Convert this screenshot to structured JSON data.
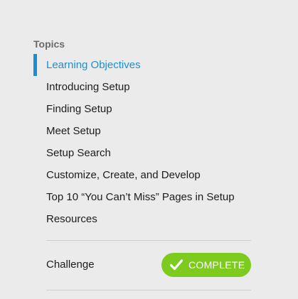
{
  "topics": {
    "heading": "Topics",
    "items": [
      {
        "label": "Learning Objectives"
      },
      {
        "label": "Introducing Setup"
      },
      {
        "label": "Finding Setup"
      },
      {
        "label": "Meet Setup"
      },
      {
        "label": "Setup Search"
      },
      {
        "label": "Customize, Create, and Develop"
      },
      {
        "label": "Top 10 “You Can’t Miss” Pages in Setup"
      },
      {
        "label": "Resources"
      }
    ],
    "active_index": 0
  },
  "challenge": {
    "label": "Challenge",
    "status_label": "COMPLETE",
    "status_icon": "checkmark-icon"
  },
  "colors": {
    "accent": "#1a8fd1",
    "complete": "#7ecb20",
    "background": "#ebebeb"
  }
}
